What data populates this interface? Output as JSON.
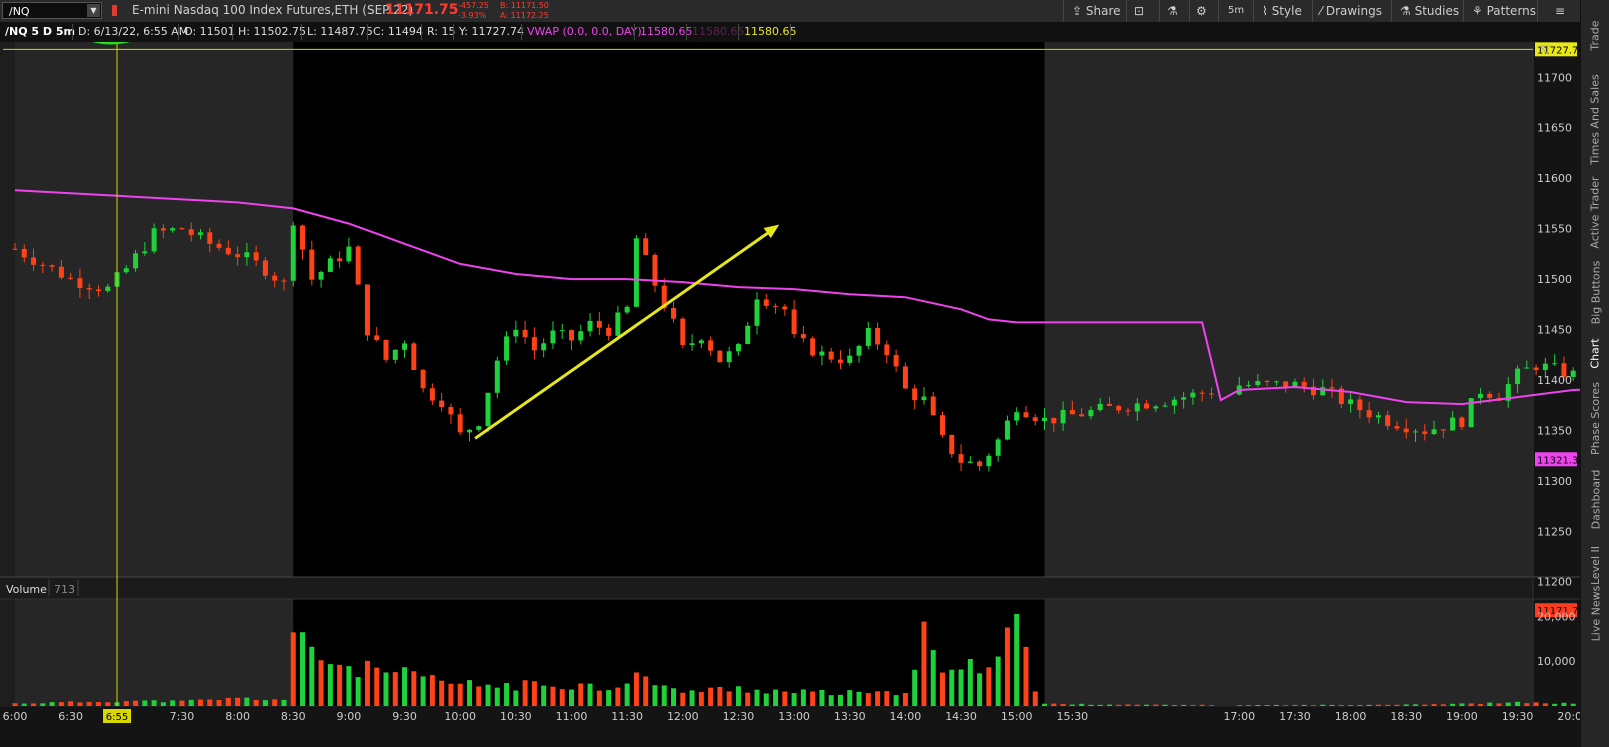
{
  "toolbar": {
    "symbol": "/NQ",
    "description": "E-mini Nasdaq 100 Index Futures,ETH (SEP 22)",
    "last": "11171.75",
    "net_change": "-457.25",
    "pct_change": "-3.93%",
    "bid": "B: 11171.50",
    "ask": "A: 11172.25",
    "share": "Share",
    "timeframe": "5m",
    "style": "Style",
    "drawings": "Drawings",
    "studies": "Studies",
    "patterns": "Patterns"
  },
  "infobar": {
    "period": "/NQ 5 D 5m",
    "date": "D: 6/13/22, 6:55 AM",
    "open": "O: 11501",
    "high": "H: 11502.75",
    "low": "L: 11487.75",
    "close": "C: 11494",
    "range": "R: 15",
    "y": "Y: 11727.74",
    "vwap_label": "VWAP (0.0, 0.0, DAY)",
    "vwap_val1": "11580.65",
    "vwap_val2": "11580.65",
    "vwap_val3": "11580.65"
  },
  "sidebar": [
    "Trade",
    "Times And Sales",
    "Active Trader",
    "Big Buttons",
    "Chart",
    "Phase Scores",
    "Dashboard",
    "Level II",
    "Live News"
  ],
  "colors": {
    "up": "#1fd13b",
    "down": "#ff4218",
    "vwap": "#ee44ee",
    "cursor": "#d8d800",
    "arrow": "#e6e61a",
    "premarket": "#262626",
    "session": "#000000"
  },
  "chart_data": {
    "type": "candlestick",
    "symbol": "/NQ",
    "interval": "5m",
    "ylim": [
      11165,
      11735
    ],
    "y_ticks": [
      11200,
      11250,
      11300,
      11350,
      11400,
      11450,
      11500,
      11550,
      11600,
      11650,
      11700
    ],
    "x_ticks": [
      "6:00",
      "6:30",
      "7:00",
      "7:30",
      "8:00",
      "8:30",
      "9:00",
      "9:30",
      "10:00",
      "10:30",
      "11:00",
      "11:30",
      "12:00",
      "12:30",
      "13:00",
      "13:30",
      "14:00",
      "14:30",
      "15:00",
      "15:30",
      "16:00",
      "16:30",
      "17:00",
      "17:30",
      "18:00",
      "18:30",
      "19:00",
      "19:30",
      "20:00"
    ],
    "x_labels_shown": [
      "6:00",
      "6:30",
      "6:55",
      "7:30",
      "8:00",
      "8:30",
      "9:00",
      "9:30",
      "10:00",
      "10:30",
      "11:00",
      "11:30",
      "12:00",
      "12:30",
      "13:00",
      "13:30",
      "14:00",
      "14:30",
      "15:00",
      "15:30",
      "17:00",
      "17:30",
      "18:00",
      "18:30",
      "19:00",
      "19:30",
      "20:00"
    ],
    "cursor_time": "6:55",
    "cursor_label": "6:55",
    "price_labels": [
      {
        "value": 11727.74,
        "text": "11727.74",
        "kind": "cursor"
      },
      {
        "value": 11321.34,
        "text": "11321.34",
        "kind": "vwap"
      },
      {
        "value": 11171.75,
        "text": "11171.75",
        "kind": "last"
      }
    ],
    "shading": [
      {
        "from": "6:00",
        "to": "8:30",
        "fill": "premarket"
      },
      {
        "from": "8:30",
        "to": "15:15",
        "fill": "session"
      },
      {
        "from": "15:15",
        "to": "20:30",
        "fill": "premarket"
      }
    ],
    "close_series": [
      [
        "6:00",
        11530
      ],
      [
        "6:30",
        11500
      ],
      [
        "6:50",
        11490
      ],
      [
        "7:00",
        11510
      ],
      [
        "7:15",
        11545
      ],
      [
        "7:30",
        11550
      ],
      [
        "7:45",
        11535
      ],
      [
        "8:00",
        11525
      ],
      [
        "8:15",
        11510
      ],
      [
        "8:25",
        11495
      ],
      [
        "8:30",
        11560
      ],
      [
        "8:40",
        11500
      ],
      [
        "9:00",
        11530
      ],
      [
        "9:10",
        11450
      ],
      [
        "9:20",
        11420
      ],
      [
        "9:30",
        11440
      ],
      [
        "9:40",
        11390
      ],
      [
        "9:50",
        11380
      ],
      [
        "10:00",
        11345
      ],
      [
        "10:10",
        11360
      ],
      [
        "10:20",
        11420
      ],
      [
        "10:30",
        11455
      ],
      [
        "10:40",
        11430
      ],
      [
        "10:50",
        11445
      ],
      [
        "11:00",
        11440
      ],
      [
        "11:10",
        11455
      ],
      [
        "11:20",
        11450
      ],
      [
        "11:30",
        11470
      ],
      [
        "11:35",
        11540
      ],
      [
        "11:45",
        11495
      ],
      [
        "11:55",
        11455
      ],
      [
        "12:00",
        11430
      ],
      [
        "12:10",
        11445
      ],
      [
        "12:20",
        11420
      ],
      [
        "12:30",
        11430
      ],
      [
        "12:40",
        11485
      ],
      [
        "12:55",
        11470
      ],
      [
        "13:00",
        11440
      ],
      [
        "13:15",
        11425
      ],
      [
        "13:30",
        11420
      ],
      [
        "13:40",
        11445
      ],
      [
        "13:50",
        11430
      ],
      [
        "14:00",
        11390
      ],
      [
        "14:10",
        11380
      ],
      [
        "14:20",
        11340
      ],
      [
        "14:30",
        11320
      ],
      [
        "14:40",
        11315
      ],
      [
        "14:50",
        11340
      ],
      [
        "15:00",
        11375
      ],
      [
        "15:15",
        11360
      ],
      [
        "15:30",
        11365
      ],
      [
        "16:00",
        11375
      ],
      [
        "16:20",
        11380
      ],
      [
        "16:35",
        11385
      ],
      [
        "17:00",
        11395
      ],
      [
        "17:30",
        11395
      ],
      [
        "17:45",
        11390
      ],
      [
        "18:00",
        11375
      ],
      [
        "18:20",
        11360
      ],
      [
        "18:40",
        11350
      ],
      [
        "19:00",
        11360
      ],
      [
        "19:10",
        11390
      ],
      [
        "19:20",
        11385
      ],
      [
        "19:30",
        11405
      ],
      [
        "19:40",
        11415
      ],
      [
        "19:50",
        11410
      ],
      [
        "20:00",
        11405
      ],
      [
        "20:15",
        11400
      ]
    ],
    "vwap": [
      [
        "6:00",
        11588
      ],
      [
        "7:00",
        11582
      ],
      [
        "8:00",
        11576
      ],
      [
        "8:30",
        11570
      ],
      [
        "9:00",
        11555
      ],
      [
        "9:30",
        11535
      ],
      [
        "10:00",
        11515
      ],
      [
        "10:30",
        11505
      ],
      [
        "11:00",
        11500
      ],
      [
        "11:30",
        11500
      ],
      [
        "12:00",
        11497
      ],
      [
        "12:30",
        11492
      ],
      [
        "13:00",
        11490
      ],
      [
        "13:30",
        11485
      ],
      [
        "14:00",
        11482
      ],
      [
        "14:30",
        11470
      ],
      [
        "14:45",
        11460
      ],
      [
        "15:00",
        11457
      ],
      [
        "16:40",
        11457
      ],
      [
        "16:50",
        11380
      ],
      [
        "17:00",
        11390
      ],
      [
        "17:30",
        11393
      ],
      [
        "18:00",
        11388
      ],
      [
        "18:30",
        11378
      ],
      [
        "19:00",
        11376
      ],
      [
        "19:30",
        11383
      ],
      [
        "20:00",
        11390
      ],
      [
        "20:30",
        11392
      ]
    ],
    "annotation_arrow": {
      "from": [
        "10:08",
        11342
      ],
      "to": [
        "12:52",
        11554
      ]
    },
    "volume": {
      "label": "Volume",
      "current": "713",
      "y_ticks": [
        10000,
        20000
      ],
      "y_tick_labels": [
        "10,000",
        "20,000"
      ],
      "ylim": [
        0,
        23000
      ],
      "points": [
        [
          "6:00",
          600
        ],
        [
          "6:30",
          900
        ],
        [
          "7:00",
          1200
        ],
        [
          "7:30",
          1100
        ],
        [
          "8:00",
          1800
        ],
        [
          "8:25",
          1500
        ],
        [
          "8:30",
          15800
        ],
        [
          "8:40",
          12500
        ],
        [
          "9:00",
          9000
        ],
        [
          "9:20",
          8000
        ],
        [
          "9:40",
          6500
        ],
        [
          "10:00",
          5000
        ],
        [
          "10:30",
          4800
        ],
        [
          "11:00",
          5200
        ],
        [
          "11:20",
          4200
        ],
        [
          "11:35",
          7500
        ],
        [
          "11:50",
          4000
        ],
        [
          "12:10",
          3500
        ],
        [
          "12:30",
          4200
        ],
        [
          "13:00",
          3200
        ],
        [
          "13:30",
          3000
        ],
        [
          "13:50",
          2800
        ],
        [
          "14:00",
          4000
        ],
        [
          "14:10",
          16300
        ],
        [
          "14:20",
          7000
        ],
        [
          "14:30",
          9500
        ],
        [
          "14:40",
          8500
        ],
        [
          "14:50",
          14500
        ],
        [
          "15:00",
          22400
        ],
        [
          "15:10",
          3500
        ],
        [
          "15:15",
          500
        ],
        [
          "16:00",
          300
        ],
        [
          "17:00",
          200
        ],
        [
          "18:00",
          250
        ],
        [
          "19:00",
          500
        ],
        [
          "19:30",
          800
        ],
        [
          "20:00",
          600
        ],
        [
          "20:30",
          500
        ]
      ]
    }
  }
}
